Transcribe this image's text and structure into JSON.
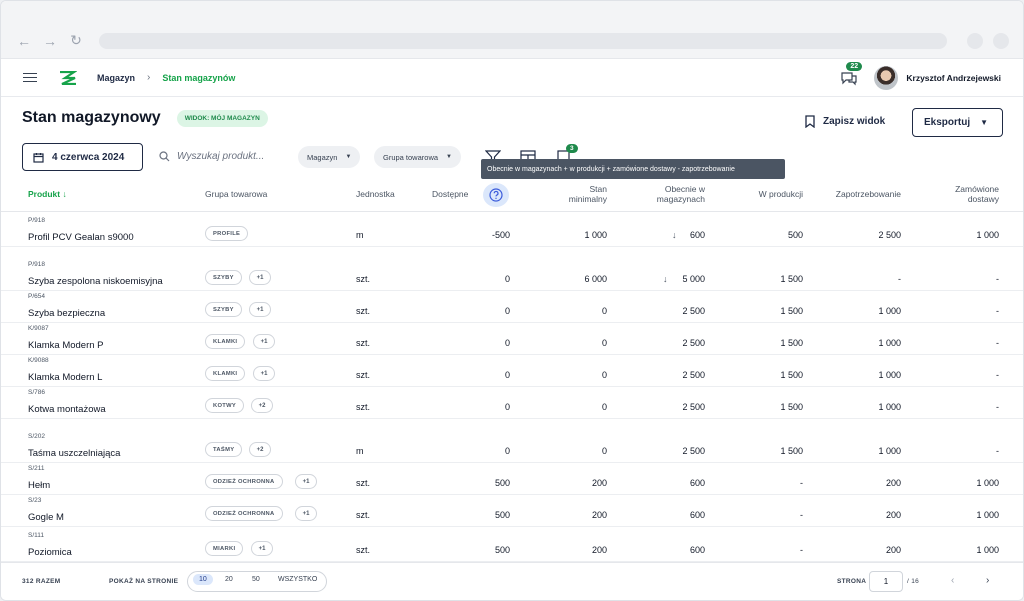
{
  "app": {
    "breadcrumb": [
      "Magazyn",
      "Stan magazynów"
    ],
    "notifications_count": "22",
    "user_name": "Krzysztof Andrzejewski"
  },
  "page": {
    "title": "Stan magazynowy",
    "view_tag": "WIDOK: MÓJ MAGAZYN",
    "save_view_label": "Zapisz widok",
    "export_label": "Eksportuj",
    "date_label": "4 czerwca 2024",
    "search_placeholder": "Wyszukaj produkt...",
    "filter_warehouse": "Magazyn",
    "filter_group": "Grupa towarowa",
    "filters_badge": "3",
    "tooltip": "Obecnie w magazynach + w produkcji + zamówione dostawy - zapotrzebowanie"
  },
  "columns": {
    "product": "Produkt",
    "group": "Grupa towarowa",
    "unit": "Jednostka",
    "available": "Dostępne",
    "min_stock_1": "Stan",
    "min_stock_2": "minimalny",
    "in_warehouses_1": "Obecnie w",
    "in_warehouses_2": "magazynach",
    "in_production": "W produkcji",
    "demand": "Zapotrzebowanie",
    "ordered_1": "Zamówione",
    "ordered_2": "dostawy"
  },
  "rows": [
    {
      "sku": "P/918",
      "name": "Profil PCV Gealan s9000",
      "tag": "PROFILE",
      "plus": "",
      "unit": "m",
      "available": "-500",
      "min_stock": "1 000",
      "in_warehouses": "600",
      "low": true,
      "in_production": "500",
      "demand": "2 500",
      "ordered": "1 000"
    },
    {
      "sku": "P/918",
      "name": "Szyba zespolona niskoemisyjna",
      "tag": "SZYBY",
      "plus": "+1",
      "unit": "szt.",
      "available": "0",
      "min_stock": "6 000",
      "in_warehouses": "5 000",
      "low": true,
      "in_production": "1 500",
      "demand": "-",
      "ordered": "-"
    },
    {
      "sku": "P/654",
      "name": "Szyba bezpieczna",
      "tag": "SZYBY",
      "plus": "+1",
      "unit": "szt.",
      "available": "0",
      "min_stock": "0",
      "in_warehouses": "2 500",
      "low": false,
      "in_production": "1 500",
      "demand": "1 000",
      "ordered": "-"
    },
    {
      "sku": "K/9087",
      "name": "Klamka Modern P",
      "tag": "KLAMKI",
      "plus": "+1",
      "unit": "szt.",
      "available": "0",
      "min_stock": "0",
      "in_warehouses": "2 500",
      "low": false,
      "in_production": "1 500",
      "demand": "1 000",
      "ordered": "-"
    },
    {
      "sku": "K/9088",
      "name": "Klamka Modern L",
      "tag": "KLAMKI",
      "plus": "+1",
      "unit": "szt.",
      "available": "0",
      "min_stock": "0",
      "in_warehouses": "2 500",
      "low": false,
      "in_production": "1 500",
      "demand": "1 000",
      "ordered": "-"
    },
    {
      "sku": "S/786",
      "name": "Kotwa montażowa",
      "tag": "KOTWY",
      "plus": "+2",
      "unit": "szt.",
      "available": "0",
      "min_stock": "0",
      "in_warehouses": "2 500",
      "low": false,
      "in_production": "1 500",
      "demand": "1 000",
      "ordered": "-"
    },
    {
      "sku": "S/202",
      "name": "Taśma uszczelniająca",
      "tag": "TAŚMY",
      "plus": "+2",
      "unit": "m",
      "available": "0",
      "min_stock": "0",
      "in_warehouses": "2 500",
      "low": false,
      "in_production": "1 500",
      "demand": "1 000",
      "ordered": "-"
    },
    {
      "sku": "S/211",
      "name": "Hełm",
      "tag": "ODZIEŻ OCHRONNA",
      "plus": "+1",
      "unit": "szt.",
      "available": "500",
      "min_stock": "200",
      "in_warehouses": "600",
      "low": false,
      "in_production": "-",
      "demand": "200",
      "ordered": "1 000"
    },
    {
      "sku": "S/23",
      "name": "Gogle M",
      "tag": "ODZIEŻ OCHRONNA",
      "plus": "+1",
      "unit": "szt.",
      "available": "500",
      "min_stock": "200",
      "in_warehouses": "600",
      "low": false,
      "in_production": "-",
      "demand": "200",
      "ordered": "1 000"
    },
    {
      "sku": "S/111",
      "name": "Poziomica",
      "tag": "MIARKI",
      "plus": "+1",
      "unit": "szt.",
      "available": "500",
      "min_stock": "200",
      "in_warehouses": "600",
      "low": false,
      "in_production": "-",
      "demand": "200",
      "ordered": "1 000"
    }
  ],
  "footer": {
    "total": "312 RAZEM",
    "per_page_label": "POKAŻ NA STRONIE",
    "per_page_options": [
      "10",
      "20",
      "50",
      "WSZYSTKO"
    ],
    "page_label": "STRONA",
    "current_page": "1",
    "total_pages": "/ 16"
  },
  "colors": {
    "accent": "#16a34a",
    "navy": "#1f2a44",
    "badge": "#1f8a4c"
  }
}
